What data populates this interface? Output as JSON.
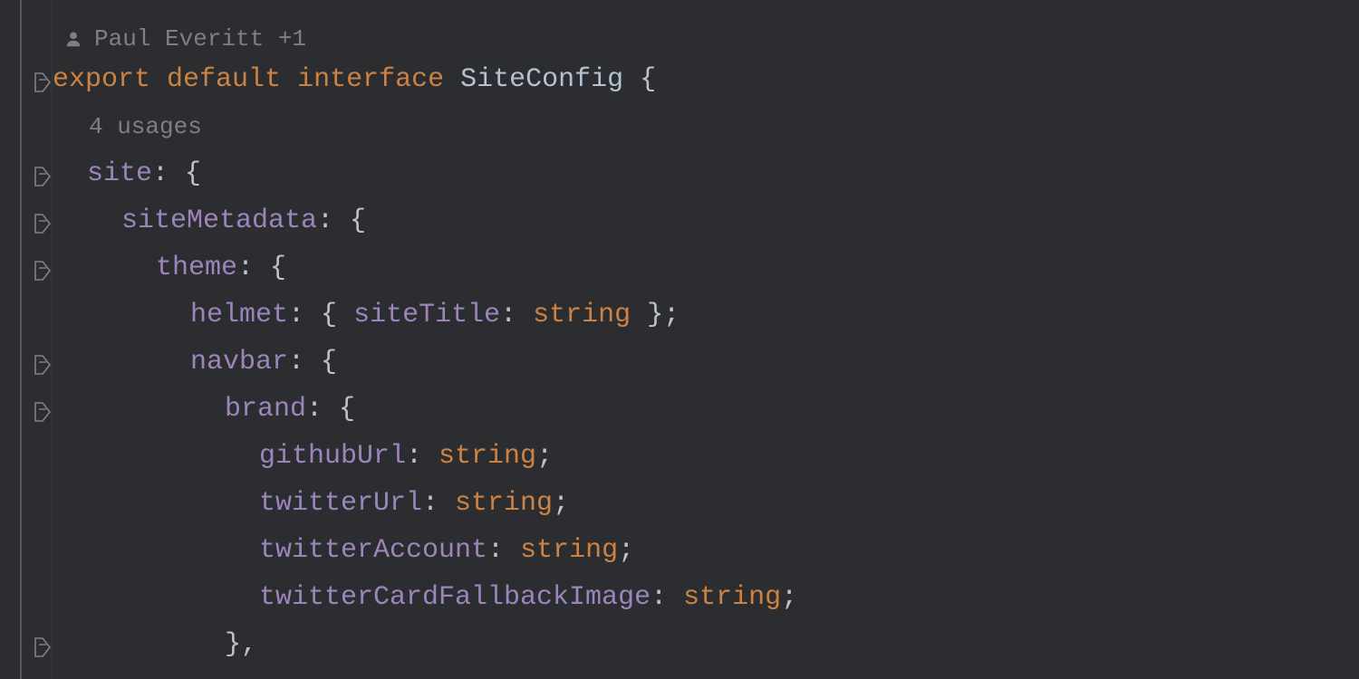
{
  "annotations": {
    "author_line": "Paul Everitt +1",
    "usages": "4 usages"
  },
  "code": {
    "kw_export": "export",
    "kw_default": "default",
    "kw_interface": "interface",
    "type_name": "SiteConfig",
    "brace_open": "{",
    "brace_close": "}",
    "brace_close_comma": "},",
    "semi": ";",
    "colon_brace": ": {",
    "prop_site": "site",
    "prop_siteMetadata": "siteMetadata",
    "prop_theme": "theme",
    "prop_helmet": "helmet",
    "prop_siteTitle": "siteTitle",
    "prop_navbar": "navbar",
    "prop_brand": "brand",
    "prop_githubUrl": "githubUrl",
    "prop_twitterUrl": "twitterUrl",
    "prop_twitterAccount": "twitterAccount",
    "prop_twitterCardFallbackImage": "twitterCardFallbackImage",
    "t_string": "string"
  }
}
